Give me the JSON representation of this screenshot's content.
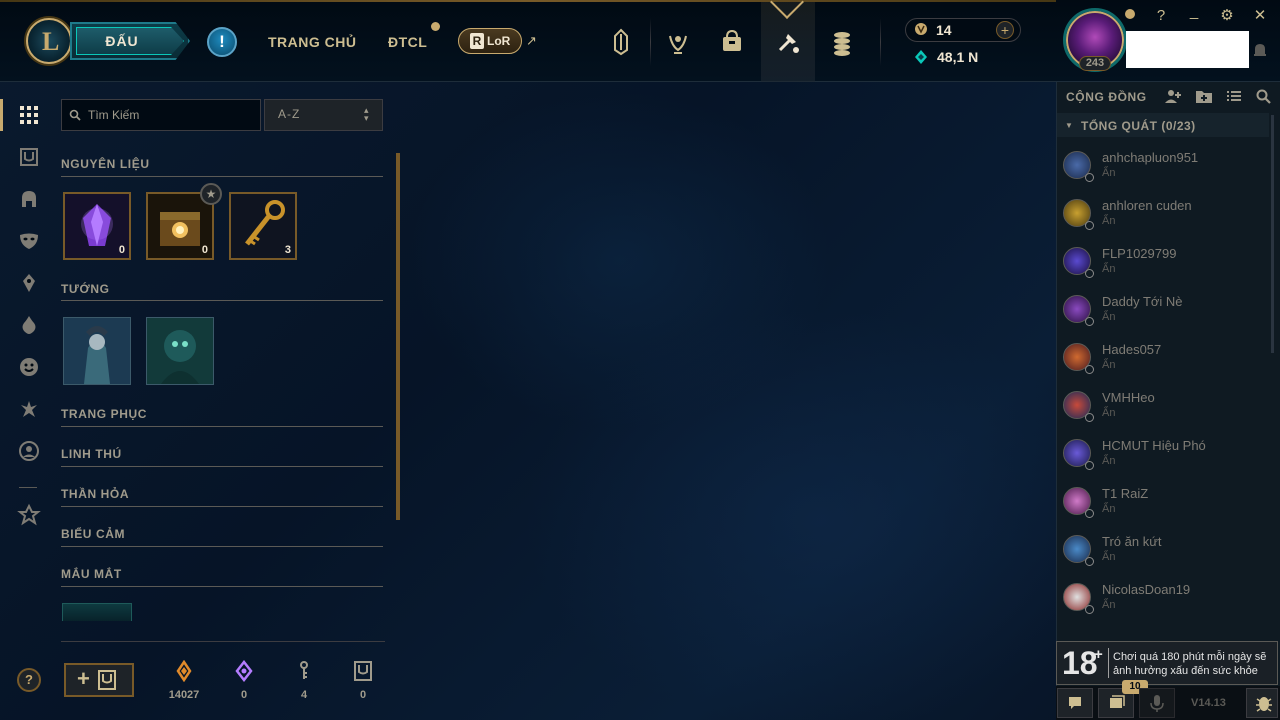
{
  "topnav": {
    "logo_letter": "L",
    "play_label": "ĐẤU",
    "alert_label": "!",
    "home_label": "TRANG CHỦ",
    "tft_label": "ĐTCL",
    "lor_label": "LoR",
    "lor_icon_letter": "R",
    "external_arrow": "↗",
    "nav_icons": [
      "champions-icon",
      "honor-icon",
      "store-bag-icon",
      "loot-icon",
      "currency-icon"
    ],
    "rp_value": "14",
    "rp_plus": "+",
    "be_value": "48,1 N",
    "profile_level": "243",
    "window_buttons": [
      "?",
      "_",
      "⚙",
      "✕"
    ]
  },
  "sidebar": {
    "icons": [
      "grid-icon",
      "chest-icon",
      "helmet-icon",
      "mask-icon",
      "ward-icon",
      "flame-icon",
      "emote-icon",
      "tft-icon",
      "profile-icon",
      "crest-icon"
    ],
    "help_label": "?"
  },
  "collection": {
    "search_placeholder": "Tìm Kiếm",
    "sort_label": "A-Z",
    "sort_arrows": "⌃⌄",
    "sections": {
      "materials": "NGUYÊN LIỆU",
      "champions": "TƯỚNG",
      "skins": "TRANG PHỤC",
      "pets": "LINH THÚ",
      "wards": "THẦN HỎA",
      "emotes": "BIỂU CẢM",
      "eyes": "MẮU MẮT"
    },
    "materials": [
      {
        "name": "essence-gem",
        "count": "0"
      },
      {
        "name": "hextech-chest",
        "count": "0"
      },
      {
        "name": "hextech-key",
        "count": "3"
      }
    ],
    "star_badge": "★",
    "bottom_stats": [
      {
        "icon": "orange-essence-icon",
        "value": "14027"
      },
      {
        "icon": "mythic-essence-icon",
        "value": "0"
      },
      {
        "icon": "key-fragment-icon",
        "value": "4"
      },
      {
        "icon": "chest-count-icon",
        "value": "0"
      }
    ],
    "craft_plus": "+"
  },
  "social": {
    "header": "CỘNG ĐỒNG",
    "group_caret": "▼",
    "group_label": "TỔNG QUÁT (0/23)",
    "friends": [
      {
        "name": "anhchapluon951",
        "status": "Ẩn"
      },
      {
        "name": "anhloren cuden",
        "status": "Ẩn"
      },
      {
        "name": "FLP1029799",
        "status": "Ẩn"
      },
      {
        "name": "Daddy Tới Nè",
        "status": "Ẩn"
      },
      {
        "name": "Hades057",
        "status": "Ẩn"
      },
      {
        "name": "VMHHeo",
        "status": "Ẩn"
      },
      {
        "name": "HCMUT Hiệu Phó",
        "status": "Ẩn"
      },
      {
        "name": "T1 RaiZ",
        "status": "Ẩn"
      },
      {
        "name": "Tró ăn kứt",
        "status": "Ẩn"
      },
      {
        "name": "NicolasDoan19",
        "status": "Ẩn"
      }
    ],
    "age_rating": "18",
    "age_plus": "+",
    "age_warning": "Chơi quá 180 phút mỗi ngày sẽ ảnh hưởng xấu đến sức khỏe",
    "mission_badge": "10",
    "version": "V14.13"
  },
  "colors": {
    "gold": "#c8aa6e",
    "gold_dark": "#785a28",
    "teal": "#0ac8b9",
    "background": "#010a13"
  }
}
